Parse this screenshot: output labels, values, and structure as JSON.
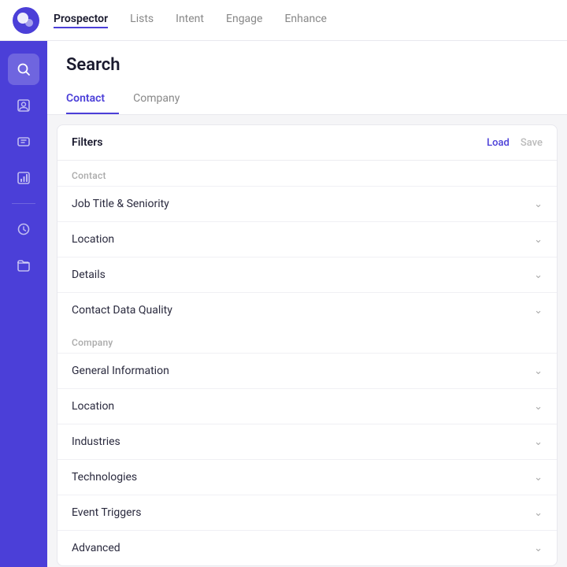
{
  "topNav": {
    "items": [
      {
        "label": "Prospector",
        "active": true
      },
      {
        "label": "Lists",
        "active": false
      },
      {
        "label": "Intent",
        "active": false
      },
      {
        "label": "Engage",
        "active": false
      },
      {
        "label": "Enhance",
        "active": false
      }
    ]
  },
  "sidebar": {
    "icons": [
      {
        "name": "search-icon",
        "symbol": "🔍",
        "active": true
      },
      {
        "name": "contact-icon",
        "symbol": "👤",
        "active": false
      },
      {
        "name": "list-icon",
        "symbol": "📋",
        "active": false
      },
      {
        "name": "chart-icon",
        "symbol": "📊",
        "active": false
      },
      {
        "name": "history-icon",
        "symbol": "🕐",
        "active": false
      },
      {
        "name": "folder-icon",
        "symbol": "🗂",
        "active": false
      }
    ]
  },
  "page": {
    "title": "Search"
  },
  "tabs": [
    {
      "label": "Contact",
      "active": true
    },
    {
      "label": "Company",
      "active": false
    }
  ],
  "filtersPanel": {
    "label": "Filters",
    "actions": {
      "load": "Load",
      "save": "Save"
    },
    "sections": [
      {
        "sectionLabel": "Contact",
        "items": [
          {
            "label": "Job Title & Seniority"
          },
          {
            "label": "Location"
          },
          {
            "label": "Details"
          },
          {
            "label": "Contact Data Quality"
          }
        ]
      },
      {
        "sectionLabel": "Company",
        "items": [
          {
            "label": "General Information"
          },
          {
            "label": "Location"
          },
          {
            "label": "Industries"
          },
          {
            "label": "Technologies"
          },
          {
            "label": "Event Triggers"
          },
          {
            "label": "Advanced"
          }
        ]
      }
    ]
  }
}
